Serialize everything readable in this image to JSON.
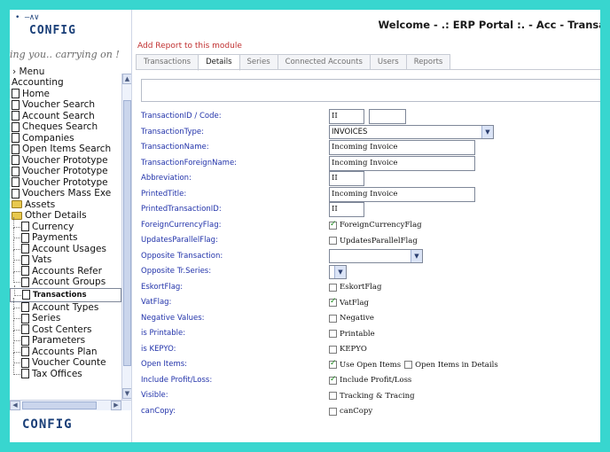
{
  "left": {
    "logo_top": "CONFIG",
    "logo_mark": "•  —∧∨",
    "tagline": "ing you.. carrying on !",
    "menu_head": "› Menu",
    "tree": [
      {
        "label": "Accounting",
        "icon": "none",
        "indent": 0
      },
      {
        "label": "Home",
        "icon": "document",
        "indent": 0
      },
      {
        "label": "Voucher Search",
        "icon": "document",
        "indent": 0
      },
      {
        "label": "Account Search",
        "icon": "document",
        "indent": 0
      },
      {
        "label": "Cheques Search",
        "icon": "document",
        "indent": 0
      },
      {
        "label": "Companies",
        "icon": "document",
        "indent": 0
      },
      {
        "label": "Open Items Search",
        "icon": "document",
        "indent": 0
      },
      {
        "label": "Voucher Prototype",
        "icon": "document",
        "indent": 0
      },
      {
        "label": "Voucher Prototype",
        "icon": "document",
        "indent": 0
      },
      {
        "label": "Voucher Prototype",
        "icon": "document",
        "indent": 0
      },
      {
        "label": "Vouchers Mass Exe",
        "icon": "document",
        "indent": 0
      },
      {
        "label": "Assets",
        "icon": "folder",
        "indent": 0
      },
      {
        "label": "Other Details",
        "icon": "folder",
        "indent": 0
      },
      {
        "label": "Currency",
        "icon": "document",
        "indent": 1
      },
      {
        "label": "Payments",
        "icon": "document",
        "indent": 1
      },
      {
        "label": "Account Usages",
        "icon": "document",
        "indent": 1
      },
      {
        "label": "Vats",
        "icon": "document",
        "indent": 1
      },
      {
        "label": "Accounts Refer",
        "icon": "document",
        "indent": 1
      },
      {
        "label": "Account Groups",
        "icon": "document",
        "indent": 1
      },
      {
        "label": "Transactions",
        "icon": "document",
        "indent": 1,
        "selected": true
      },
      {
        "label": "Account Types",
        "icon": "document",
        "indent": 1
      },
      {
        "label": "Series",
        "icon": "document",
        "indent": 1
      },
      {
        "label": "Cost Centers",
        "icon": "document",
        "indent": 1
      },
      {
        "label": "Parameters",
        "icon": "document",
        "indent": 1
      },
      {
        "label": "Accounts Plan",
        "icon": "document",
        "indent": 1
      },
      {
        "label": "Voucher Counte",
        "icon": "document",
        "indent": 1
      },
      {
        "label": "Tax Offices",
        "icon": "document",
        "indent": 1
      }
    ],
    "logo_bottom": "CONFIG"
  },
  "header": {
    "welcome": "Welcome - .: ERP Portal :. - Acc - Transa",
    "add_report": "Add Report to this module"
  },
  "tabs": [
    "Transactions",
    "Details",
    "Series",
    "Connected Accounts",
    "Users",
    "Reports"
  ],
  "active_tab": "Details",
  "form": {
    "rows": [
      {
        "label": "TransactionID / Code:",
        "kind": "pair",
        "values": [
          "II",
          ""
        ]
      },
      {
        "label": "TransactionType:",
        "kind": "select",
        "value": "INVOICES"
      },
      {
        "label": "TransactionName:",
        "kind": "text",
        "value": "Incoming Invoice"
      },
      {
        "label": "TransactionForeignName:",
        "kind": "text",
        "value": "Incoming Invoice"
      },
      {
        "label": "Abbreviation:",
        "kind": "short",
        "value": "II"
      },
      {
        "label": "PrintedTitle:",
        "kind": "text",
        "value": "Incoming Invoice"
      },
      {
        "label": "PrintedTransactionID:",
        "kind": "short",
        "value": "II"
      },
      {
        "label": "ForeignCurrencyFlag:",
        "kind": "check",
        "checks": [
          {
            "text": "ForeignCurrencyFlag",
            "on": true
          }
        ]
      },
      {
        "label": "UpdatesParallelFlag:",
        "kind": "check",
        "checks": [
          {
            "text": "UpdatesParallelFlag",
            "on": false
          }
        ]
      },
      {
        "label": "Opposite Transaction:",
        "kind": "select_wide",
        "value": ""
      },
      {
        "label": "Opposite Tr.Series:",
        "kind": "select_small",
        "value": ""
      },
      {
        "label": "EskortFlag:",
        "kind": "check",
        "checks": [
          {
            "text": "EskortFlag",
            "on": false
          }
        ]
      },
      {
        "label": "VatFlag:",
        "kind": "check",
        "checks": [
          {
            "text": "VatFlag",
            "on": true
          }
        ]
      },
      {
        "label": "Negative Values:",
        "kind": "check",
        "checks": [
          {
            "text": "Negative",
            "on": false
          }
        ]
      },
      {
        "label": "is Printable:",
        "kind": "check",
        "checks": [
          {
            "text": "Printable",
            "on": false
          }
        ]
      },
      {
        "label": "is KEPYO:",
        "kind": "check",
        "checks": [
          {
            "text": "KEPYO",
            "on": false
          }
        ]
      },
      {
        "label": "Open Items:",
        "kind": "check",
        "checks": [
          {
            "text": "Use Open Items",
            "on": true
          },
          {
            "text": "Open Items in Details",
            "on": false
          }
        ]
      },
      {
        "label": "Include Profit/Loss:",
        "kind": "check",
        "checks": [
          {
            "text": "Include Profit/Loss",
            "on": true
          }
        ]
      },
      {
        "label": "Visible:",
        "kind": "check",
        "checks": [
          {
            "text": "Tracking & Tracing",
            "on": false
          }
        ]
      },
      {
        "label": "canCopy:",
        "kind": "check",
        "checks": [
          {
            "text": "canCopy",
            "on": false
          }
        ]
      }
    ]
  },
  "colors": {
    "frame": "#38d6cf",
    "label": "#2233aa",
    "add_report": "#c03030",
    "logo": "#1a3f78"
  },
  "icons": {
    "scroll_up": "▲",
    "scroll_down": "▼",
    "scroll_left": "◀",
    "scroll_right": "▶",
    "dropdown": "▼"
  }
}
